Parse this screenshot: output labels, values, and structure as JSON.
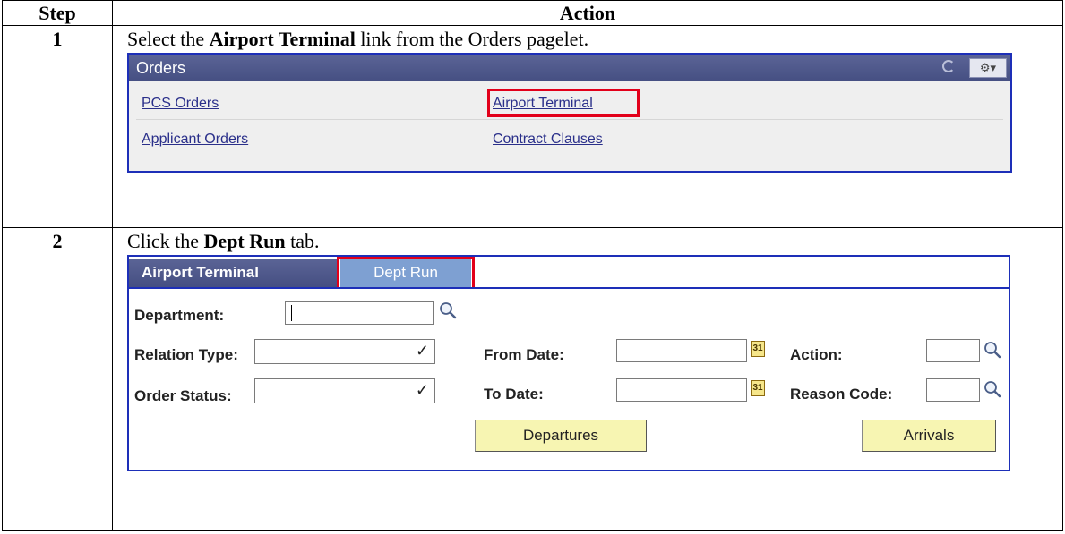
{
  "table": {
    "header_step": "Step",
    "header_action": "Action"
  },
  "steps": [
    {
      "number": "1",
      "text_pre": "Select the ",
      "text_bold": "Airport Terminal",
      "text_post": " link from the Orders pagelet."
    },
    {
      "number": "2",
      "text_pre": "Click the ",
      "text_bold": "Dept Run",
      "text_post": " tab."
    }
  ],
  "orders_pagelet": {
    "title": "Orders",
    "gear_label": "⚙▾",
    "links": [
      "PCS Orders",
      "Airport Terminal",
      "Applicant Orders",
      "Contract Clauses"
    ]
  },
  "airport_terminal": {
    "tab_active": "Airport Terminal",
    "tab_inactive": "Dept Run",
    "department_label": "Department:",
    "relation_type_label": "Relation Type:",
    "order_status_label": "Order Status:",
    "from_date_label": "From Date:",
    "to_date_label": "To Date:",
    "action_label": "Action:",
    "reason_code_label": "Reason Code:",
    "calendar_glyph": "31",
    "departures_button": "Departures",
    "arrivals_button": "Arrivals"
  },
  "colors": {
    "header_bg": "#454f82",
    "border_blue": "#1d2fb8",
    "highlight_red": "#e2001a",
    "button_yellow": "#f7f5b2",
    "link_color": "#2a2f8a"
  }
}
